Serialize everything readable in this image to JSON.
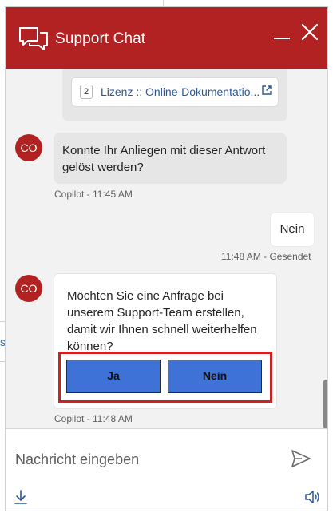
{
  "header": {
    "title": "Support Chat"
  },
  "reference": {
    "number": "2",
    "link_text": "Lizenz :: Online-Dokumentatio..."
  },
  "messages": [
    {
      "sender": "bot",
      "avatar": "CO",
      "text": "Konnte Ihr Anliegen mit dieser Antwort gelöst werden?",
      "meta": "Copilot - 11:45 AM"
    },
    {
      "sender": "user",
      "text": "Nein",
      "meta": "11:48 AM - Gesendet"
    },
    {
      "sender": "bot",
      "avatar": "CO",
      "text": "Möchten Sie eine Anfrage bei unserem Support-Team erstellen, damit wir Ihnen schnell weiterhelfen können?",
      "choices": [
        "Ja",
        "Nein"
      ],
      "meta": "Copilot - 11:48 AM"
    }
  ],
  "composer": {
    "placeholder": "Nachricht eingeben"
  },
  "background": {
    "link_fragment": "s"
  },
  "colors": {
    "header": "#b22222",
    "choice_button": "#3f72d6",
    "highlight_border": "#cc2222",
    "link": "#2b5797"
  }
}
